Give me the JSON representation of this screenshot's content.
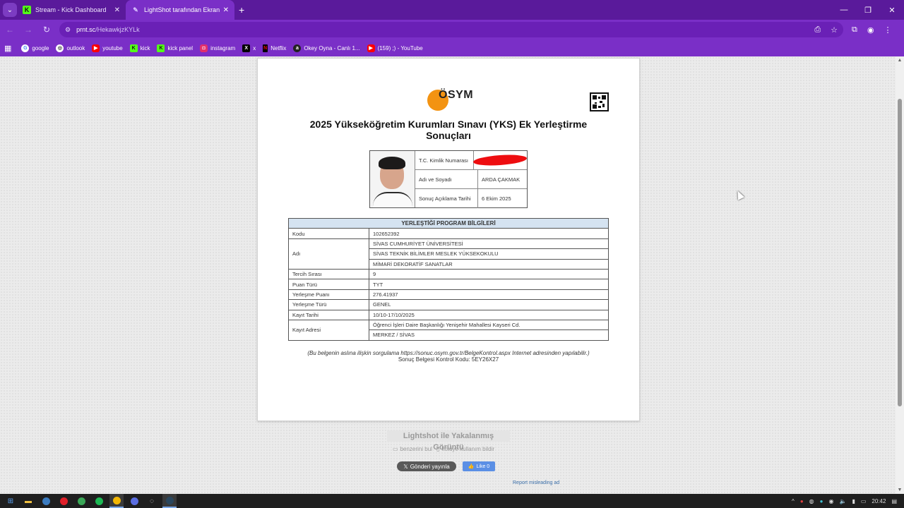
{
  "browser": {
    "tabs": [
      {
        "title": "Stream - Kick Dashboard",
        "favicon": "kick-icon",
        "active": false
      },
      {
        "title": "LightShot tarafından Ekran Görü",
        "favicon": "feather-icon",
        "active": true
      }
    ],
    "url_host": "prnt.sc",
    "url_path": "/HekawkjzKYLk",
    "bookmarks": [
      {
        "label": "google",
        "icon": "google-icon",
        "color": "#ffffff"
      },
      {
        "label": "outlook",
        "icon": "outlook-icon",
        "color": "#ffffff"
      },
      {
        "label": "youtube",
        "icon": "youtube-icon",
        "color": "#ff0000"
      },
      {
        "label": "kick",
        "icon": "kick-icon",
        "color": "#53fc18"
      },
      {
        "label": "kick panel",
        "icon": "kick-icon",
        "color": "#53fc18"
      },
      {
        "label": "instagram",
        "icon": "instagram-icon",
        "color": "#e1306c"
      },
      {
        "label": "x",
        "icon": "x-icon",
        "color": "#000000"
      },
      {
        "label": "Netflix",
        "icon": "netflix-icon",
        "color": "#e50914"
      },
      {
        "label": "Okey Oyna - Canlı 1...",
        "icon": "okey-icon",
        "color": "#222222"
      },
      {
        "label": "(159) ;) - YouTube",
        "icon": "youtube-icon",
        "color": "#ff0000"
      }
    ]
  },
  "document": {
    "logo_text": "ÖSYM",
    "title": "2025 Yükseköğretim Kurumları Sınavı (YKS) Ek Yerleştirme Sonuçları",
    "person": {
      "rows": [
        {
          "label": "T.C. Kimlik Numarası",
          "value": ""
        },
        {
          "label": "Adı ve Soyadı",
          "value": "ARDA ÇAKMAK"
        },
        {
          "label": "Sonuç Açıklama Tarihi",
          "value": "6 Ekim 2025"
        }
      ]
    },
    "program": {
      "header": "YERLEŞTİĞİ PROGRAM BİLGİLERİ",
      "kodu_label": "Kodu",
      "kodu": "102652392",
      "adi_label": "Adı",
      "adi_lines": [
        "SİVAS CUMHURİYET ÜNİVERSİTESİ",
        "SİVAS TEKNİK BİLİMLER MESLEK YÜKSEKOKULU",
        "MİMARİ DEKORATİF SANATLAR"
      ],
      "rows": [
        {
          "label": "Tercih Sırası",
          "value": "9"
        },
        {
          "label": "Puan Türü",
          "value": "TYT"
        },
        {
          "label": "Yerleşme Puanı",
          "value": "276.41937"
        },
        {
          "label": "Yerleşme Türü",
          "value": "GENEL"
        },
        {
          "label": "Kayıt Tarihi",
          "value": "10/10-17/10/2025"
        }
      ],
      "kayit_adresi_label": "Kayıt Adresi",
      "kayit_adresi_lines": [
        "Öğrenci İşleri Daire Başkanlığı Yenişehir Mahallesi Kayseri Cd.",
        "MERKEZ / SİVAS"
      ]
    },
    "note": "(Bu belgenin aslına ilişkin sorgulama https://sonuc.osym.gov.tr/BelgeKontrol.aspx Internet adresinden yapılabilir.)",
    "control_code": "Sonuç Belgesi Kontrol Kodu: 5EY26X27"
  },
  "lightshot": {
    "caption": "Lightshot ile Yakalanmış Görüntü",
    "find_similar": "benzerini bul",
    "report_abuse": "kötüye kullanım bildir",
    "tweet": "Gönderi yayınla",
    "like": "Like 0",
    "report_ad": "Report misleading ad"
  },
  "taskbar": {
    "clock": "20:42"
  }
}
